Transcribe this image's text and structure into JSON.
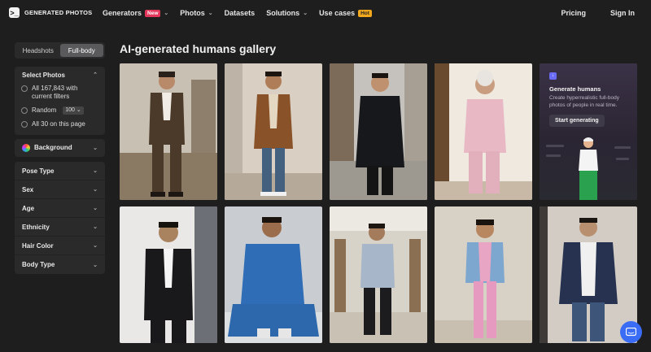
{
  "logo": {
    "mark": ">_",
    "text": "GENERATED PHOTOS"
  },
  "nav": {
    "items": [
      {
        "label": "Generators",
        "badge": "New"
      },
      {
        "label": "Photos"
      },
      {
        "label": "Datasets"
      },
      {
        "label": "Solutions"
      },
      {
        "label": "Use cases",
        "badge": "Hot"
      }
    ],
    "pricing": "Pricing",
    "signin": "Sign In"
  },
  "sidebar": {
    "segment": {
      "headshots": "Headshots",
      "fullbody": "Full-body",
      "active": "Full-body"
    },
    "select_photos": {
      "title": "Select Photos",
      "option_all": "All 167,843 with current filters",
      "option_random": "Random",
      "random_value": "100",
      "option_page": "All 30 on this page"
    },
    "background": "Background",
    "filters": [
      "Pose Type",
      "Sex",
      "Age",
      "Ethnicity",
      "Hair Color",
      "Body Type"
    ]
  },
  "main": {
    "title": "AI-generated humans gallery",
    "promo": {
      "title": "Generate humans",
      "desc": "Create hyperrealistic full-body photos of people in real time.",
      "button": "Start generating"
    }
  },
  "colors": {
    "accent": "#3b6cf5",
    "new_badge": "#e2365b",
    "hot_badge": "#f2a81d"
  }
}
